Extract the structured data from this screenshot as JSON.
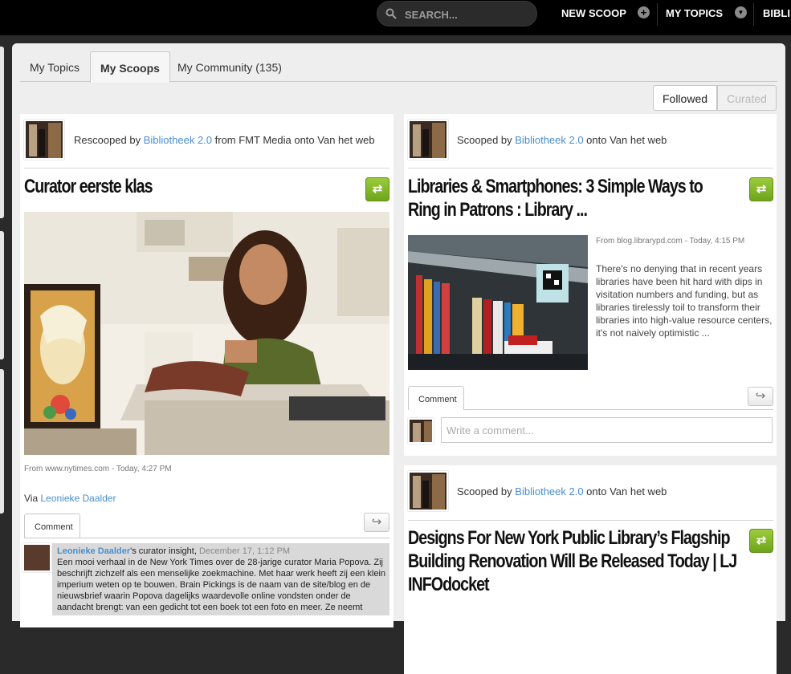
{
  "topbar": {
    "search_placeholder": "SEARCH...",
    "new_scoop": "NEW SCOOP",
    "new_scoop_icon": "+",
    "my_topics": "MY TOPICS",
    "my_topics_icon": "▼",
    "truncated_item": "BIBLI"
  },
  "tabs": [
    "My Topics",
    "My Scoops",
    "My Community (135)"
  ],
  "toggle": {
    "followed": "Followed",
    "curated": "Curated"
  },
  "cards": [
    {
      "byline_prefix": "Rescooped by ",
      "curator": "Bibliotheek 2.0",
      "byline_suffix": " from FMT Media onto Van het web",
      "title": "Curator eerste klas",
      "rescoop_icon": "rescoop-icon",
      "source": "From www.nytimes.com - Today, 4:27 PM",
      "via_prefix": "Via ",
      "via_name": "Leonieke Daalder",
      "comment_tab": "Comment",
      "insight": {
        "author": "Leonieke Daalder",
        "label": "'s curator insight, ",
        "date": "December 17, 1:12 PM",
        "text": "Een mooi verhaal in de New York Times over de 28-jarige curator Maria Popova. Zij beschrijft zichzelf als een menselijke zoekmachine. Met haar werk heeft zij een klein imperium weten op te bouwen. Brain Pickings is de naam van de site/blog en de nieuwsbrief waarin Popova dagelijks waardevolle online vondsten onder de aandacht brengt: van een gedicht tot een boek tot een foto en meer. Ze neemt"
      }
    },
    {
      "byline_prefix": "Scooped by ",
      "curator": "Bibliotheek 2.0",
      "byline_suffix": " onto Van het web",
      "title": "Libraries & Smartphones: 3 Simple Ways to Ring in Patrons : Library ...",
      "source": "From blog.librarypd.com - Today, 4:15 PM",
      "excerpt": "There's no denying that in recent years libraries have been hit hard with dips in visitation numbers and funding, but as libraries tirelessly toil to transform their libraries into high-value resource centers, it's not naively optimistic ...",
      "comment_tab": "Comment",
      "comment_placeholder": "Write a comment..."
    },
    {
      "byline_prefix": "Scooped by ",
      "curator": "Bibliotheek 2.0",
      "byline_suffix": " onto Van het web",
      "title": "Designs For New York Public Library’s Flagship Building Renovation Will Be Released Today | LJ INFOdocket"
    }
  ]
}
